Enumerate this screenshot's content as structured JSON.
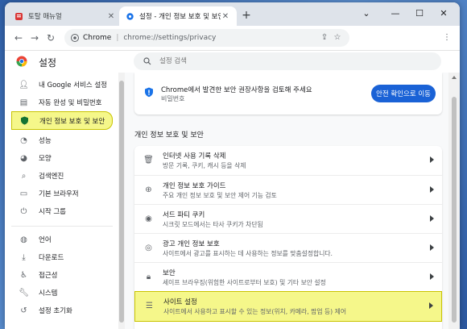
{
  "tabs": [
    {
      "label": "토탈 매뉴얼",
      "active": false
    },
    {
      "label": "설정 - 개인 정보 보호 및 보안",
      "active": true
    }
  ],
  "omnibox": {
    "site_label": "Chrome",
    "separator": "|",
    "url": "chrome://settings/privacy"
  },
  "settings": {
    "title": "설정",
    "search_placeholder": "설정 검색"
  },
  "sidebar": {
    "items": [
      {
        "label": "내 Google 서비스 설정",
        "icon": "person-icon"
      },
      {
        "label": "자동 완성 및 비밀번호",
        "icon": "clipboard-icon"
      },
      {
        "label": "개인 정보 보호 및 보안",
        "icon": "shield-icon",
        "active": true
      },
      {
        "label": "성능",
        "icon": "speedometer-icon"
      },
      {
        "label": "모양",
        "icon": "palette-icon"
      },
      {
        "label": "검색엔진",
        "icon": "search-icon"
      },
      {
        "label": "기본 브라우저",
        "icon": "browser-icon"
      },
      {
        "label": "시작 그룹",
        "icon": "power-icon"
      },
      {
        "label": "언어",
        "icon": "globe-icon"
      },
      {
        "label": "다운로드",
        "icon": "download-icon"
      },
      {
        "label": "접근성",
        "icon": "accessibility-icon"
      },
      {
        "label": "시스템",
        "icon": "wrench-icon"
      },
      {
        "label": "설정 초기화",
        "icon": "reset-icon"
      }
    ]
  },
  "safety_check": {
    "message": "Chrome에서 발견한 보안 권장사항을 검토해 주세요",
    "sub": "비밀번호",
    "button": "안전 확인으로 이동"
  },
  "privacy_section": {
    "title": "개인 정보 보호 및 보안",
    "rows": [
      {
        "title": "인터넷 사용 기록 삭제",
        "desc": "방문 기록, 쿠키, 캐시 등을 삭제",
        "icon": "trash-icon"
      },
      {
        "title": "개인 정보 보호 가이드",
        "desc": "주요 개인 정보 보호 및 보안 제어 기능 검토",
        "icon": "compass-icon"
      },
      {
        "title": "서드 파티 쿠키",
        "desc": "시크릿 모드에서는 타사 쿠키가 차단됨",
        "icon": "cookie-icon"
      },
      {
        "title": "광고 개인 정보 보호",
        "desc": "사이트에서 광고를 표시하는 데 사용하는 정보를 맞춤설정합니다.",
        "icon": "ad-privacy-icon"
      },
      {
        "title": "보안",
        "desc": "세이프 브라우징(위험한 사이트로부터 보호) 및 기타 보안 설정",
        "icon": "lock-icon"
      },
      {
        "title": "사이트 설정",
        "desc": "사이트에서 사용하고 표시할 수 있는 정보(위치, 카메라, 팝업 등) 제어",
        "icon": "sliders-icon",
        "highlight": true
      }
    ]
  },
  "colors": {
    "accent": "#1a62d6",
    "highlight": "#f5f78a",
    "highlight_border": "#c9c400"
  }
}
